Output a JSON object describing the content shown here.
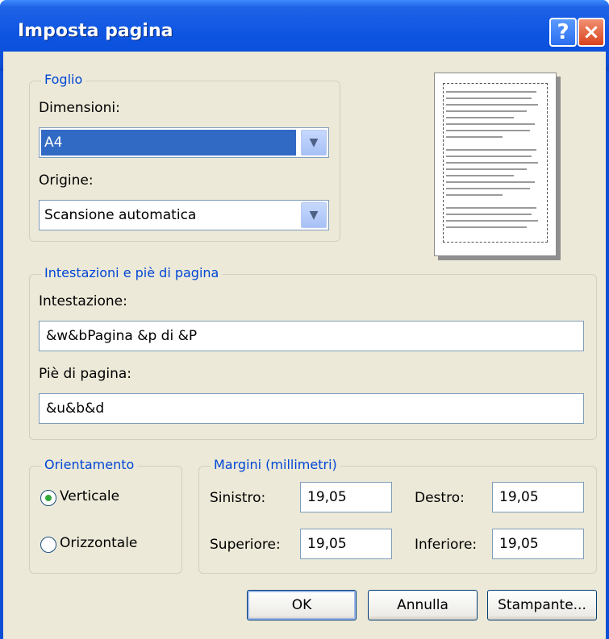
{
  "title": "Imposta pagina",
  "title_buttons": {
    "help": "?",
    "close": "×"
  },
  "sheet": {
    "legend": "Foglio",
    "size_label": "Dimensioni:",
    "size_value": "A4",
    "source_label": "Origine:",
    "source_value": "Scansione automatica"
  },
  "headers_footers": {
    "legend": "Intestazioni e piè di pagina",
    "header_label": "Intestazione:",
    "header_value": "&w&bPagina &p di &P",
    "footer_label": "Piè di pagina:",
    "footer_value": "&u&b&d"
  },
  "orientation": {
    "legend": "Orientamento",
    "portrait": "Verticale",
    "landscape": "Orizzontale",
    "selected": "portrait"
  },
  "margins": {
    "legend": "Margini (millimetri)",
    "left_label": "Sinistro:",
    "left_value": "19,05",
    "right_label": "Destro:",
    "right_value": "19,05",
    "top_label": "Superiore:",
    "top_value": "19,05",
    "bottom_label": "Inferiore:",
    "bottom_value": "19,05"
  },
  "buttons": {
    "ok": "OK",
    "cancel": "Annulla",
    "printer": "Stampante..."
  },
  "icons": {
    "dropdown": "chevron-down-icon",
    "help": "help-icon",
    "close": "close-icon"
  }
}
